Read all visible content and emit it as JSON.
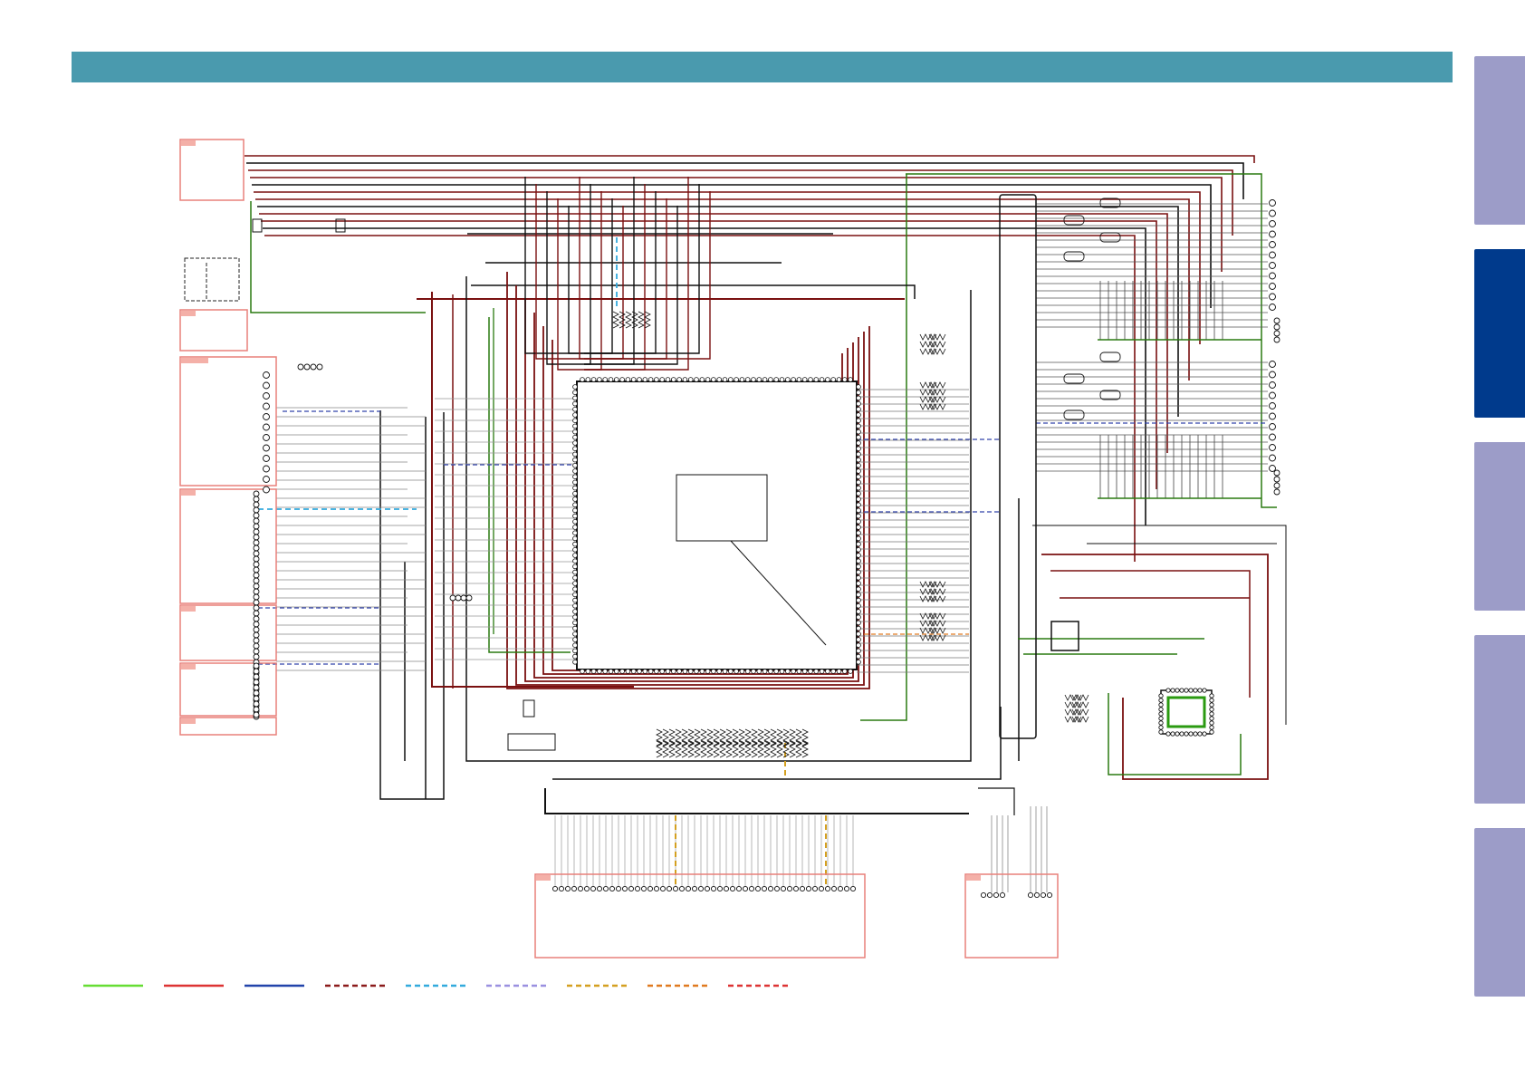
{
  "header": {
    "title": ""
  },
  "side_tabs": [
    {
      "label": "",
      "active": false
    },
    {
      "label": "",
      "active": true
    },
    {
      "label": "",
      "active": false
    },
    {
      "label": "",
      "active": false
    },
    {
      "label": "",
      "active": false
    }
  ],
  "diagram": {
    "type": "schematic",
    "main_ic_label": "",
    "colors": {
      "wire_dark": "#111111",
      "wire_maroon": "#7a1010",
      "wire_green": "#2a7a10",
      "connector_frame": "#e8807a",
      "accent_blue": "#1a7ab0"
    }
  },
  "legend": [
    {
      "color": "#66dd33",
      "style": "solid"
    },
    {
      "color": "#dd3333",
      "style": "solid"
    },
    {
      "color": "#2244aa",
      "style": "solid"
    },
    {
      "color": "#8b1a1a",
      "style": "dashed"
    },
    {
      "color": "#33aadd",
      "style": "dashed"
    },
    {
      "color": "#9a90e0",
      "style": "dashed"
    },
    {
      "color": "#d4a020",
      "style": "dashed"
    },
    {
      "color": "#e07a20",
      "style": "dashed"
    },
    {
      "color": "#dd3333",
      "style": "dashed"
    }
  ]
}
